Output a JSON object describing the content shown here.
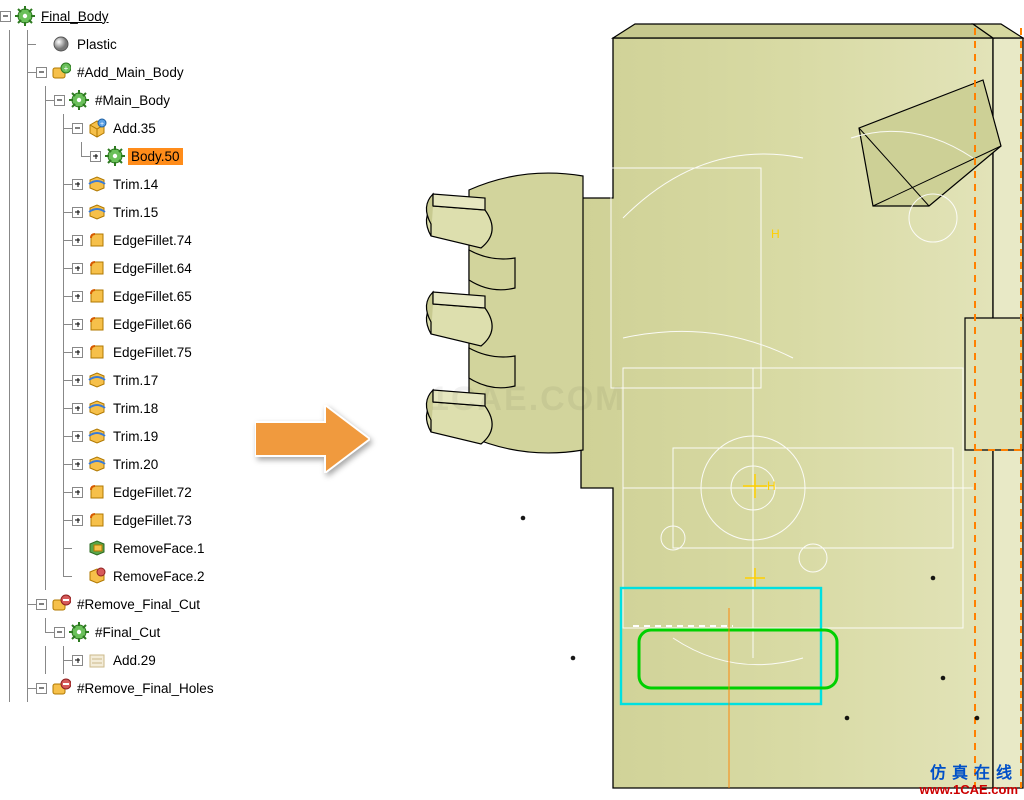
{
  "tree": {
    "root": {
      "label": "Final_Body",
      "icon": "gear-green",
      "toggle": "minus",
      "selected": false,
      "underline": true
    },
    "nodes": [
      {
        "depth": 1,
        "toggle": null,
        "icon": "sphere-grey",
        "label": "Plastic",
        "last": false
      },
      {
        "depth": 1,
        "toggle": "minus",
        "icon": "add-body",
        "label": "#Add_Main_Body",
        "last": false
      },
      {
        "depth": 2,
        "toggle": "minus",
        "icon": "gear-green",
        "label": "#Main_Body",
        "last": false,
        "guides": [
          true
        ]
      },
      {
        "depth": 3,
        "toggle": "minus",
        "icon": "add-solid",
        "label": "Add.35",
        "last": false,
        "guides": [
          true,
          false
        ]
      },
      {
        "depth": 4,
        "toggle": "plus",
        "icon": "gear-green",
        "label": "Body.50",
        "last": true,
        "guides": [
          true,
          false,
          true
        ],
        "selected": true
      },
      {
        "depth": 3,
        "toggle": "plus",
        "icon": "trim",
        "label": "Trim.14",
        "last": false,
        "guides": [
          true,
          false
        ]
      },
      {
        "depth": 3,
        "toggle": "plus",
        "icon": "trim",
        "label": "Trim.15",
        "last": false,
        "guides": [
          true,
          false
        ]
      },
      {
        "depth": 3,
        "toggle": "plus",
        "icon": "fillet",
        "label": "EdgeFillet.74",
        "last": false,
        "guides": [
          true,
          false
        ]
      },
      {
        "depth": 3,
        "toggle": "plus",
        "icon": "fillet",
        "label": "EdgeFillet.64",
        "last": false,
        "guides": [
          true,
          false
        ]
      },
      {
        "depth": 3,
        "toggle": "plus",
        "icon": "fillet",
        "label": "EdgeFillet.65",
        "last": false,
        "guides": [
          true,
          false
        ]
      },
      {
        "depth": 3,
        "toggle": "plus",
        "icon": "fillet",
        "label": "EdgeFillet.66",
        "last": false,
        "guides": [
          true,
          false
        ]
      },
      {
        "depth": 3,
        "toggle": "plus",
        "icon": "fillet",
        "label": "EdgeFillet.75",
        "last": false,
        "guides": [
          true,
          false
        ]
      },
      {
        "depth": 3,
        "toggle": "plus",
        "icon": "trim",
        "label": "Trim.17",
        "last": false,
        "guides": [
          true,
          false
        ]
      },
      {
        "depth": 3,
        "toggle": "plus",
        "icon": "trim",
        "label": "Trim.18",
        "last": false,
        "guides": [
          true,
          false
        ]
      },
      {
        "depth": 3,
        "toggle": "plus",
        "icon": "trim",
        "label": "Trim.19",
        "last": false,
        "guides": [
          true,
          false
        ]
      },
      {
        "depth": 3,
        "toggle": "plus",
        "icon": "trim",
        "label": "Trim.20",
        "last": false,
        "guides": [
          true,
          false
        ]
      },
      {
        "depth": 3,
        "toggle": "plus",
        "icon": "fillet",
        "label": "EdgeFillet.72",
        "last": false,
        "guides": [
          true,
          false
        ]
      },
      {
        "depth": 3,
        "toggle": "plus",
        "icon": "fillet",
        "label": "EdgeFillet.73",
        "last": false,
        "guides": [
          true,
          false
        ]
      },
      {
        "depth": 3,
        "toggle": null,
        "icon": "removeface",
        "label": "RemoveFace.1",
        "last": false,
        "guides": [
          true,
          false
        ]
      },
      {
        "depth": 3,
        "toggle": null,
        "icon": "removeface2",
        "label": "RemoveFace.2",
        "last": true,
        "guides": [
          true,
          false
        ]
      },
      {
        "depth": 1,
        "toggle": "minus",
        "icon": "remove-body",
        "label": "#Remove_Final_Cut",
        "last": false
      },
      {
        "depth": 2,
        "toggle": "minus",
        "icon": "gear-green",
        "label": "#Final_Cut",
        "last": true,
        "guides": [
          true
        ]
      },
      {
        "depth": 3,
        "toggle": "plus",
        "icon": "add-pale",
        "label": "Add.29",
        "last": false,
        "guides": [
          true,
          false
        ]
      },
      {
        "depth": 1,
        "toggle": "minus",
        "icon": "remove-body",
        "label": "#Remove_Final_Holes",
        "last": false
      }
    ]
  },
  "watermark": {
    "faint": "1CAE.COM",
    "cn": "仿真在线",
    "en": "www.1CAE.com"
  },
  "colors": {
    "arrow_fill": "#f09a3e",
    "arrow_stroke": "#ffffff",
    "body_fill": "#d6d8a0",
    "body_fill_light": "#e6e7c0",
    "body_stroke": "#000000",
    "construction": "#ffffff",
    "axis_x": "#00c000",
    "axis_y": "#ffd000",
    "highlight_cyan": "#00e0e0",
    "highlight_green": "#00d000",
    "dash_orange": "#ff8000"
  }
}
